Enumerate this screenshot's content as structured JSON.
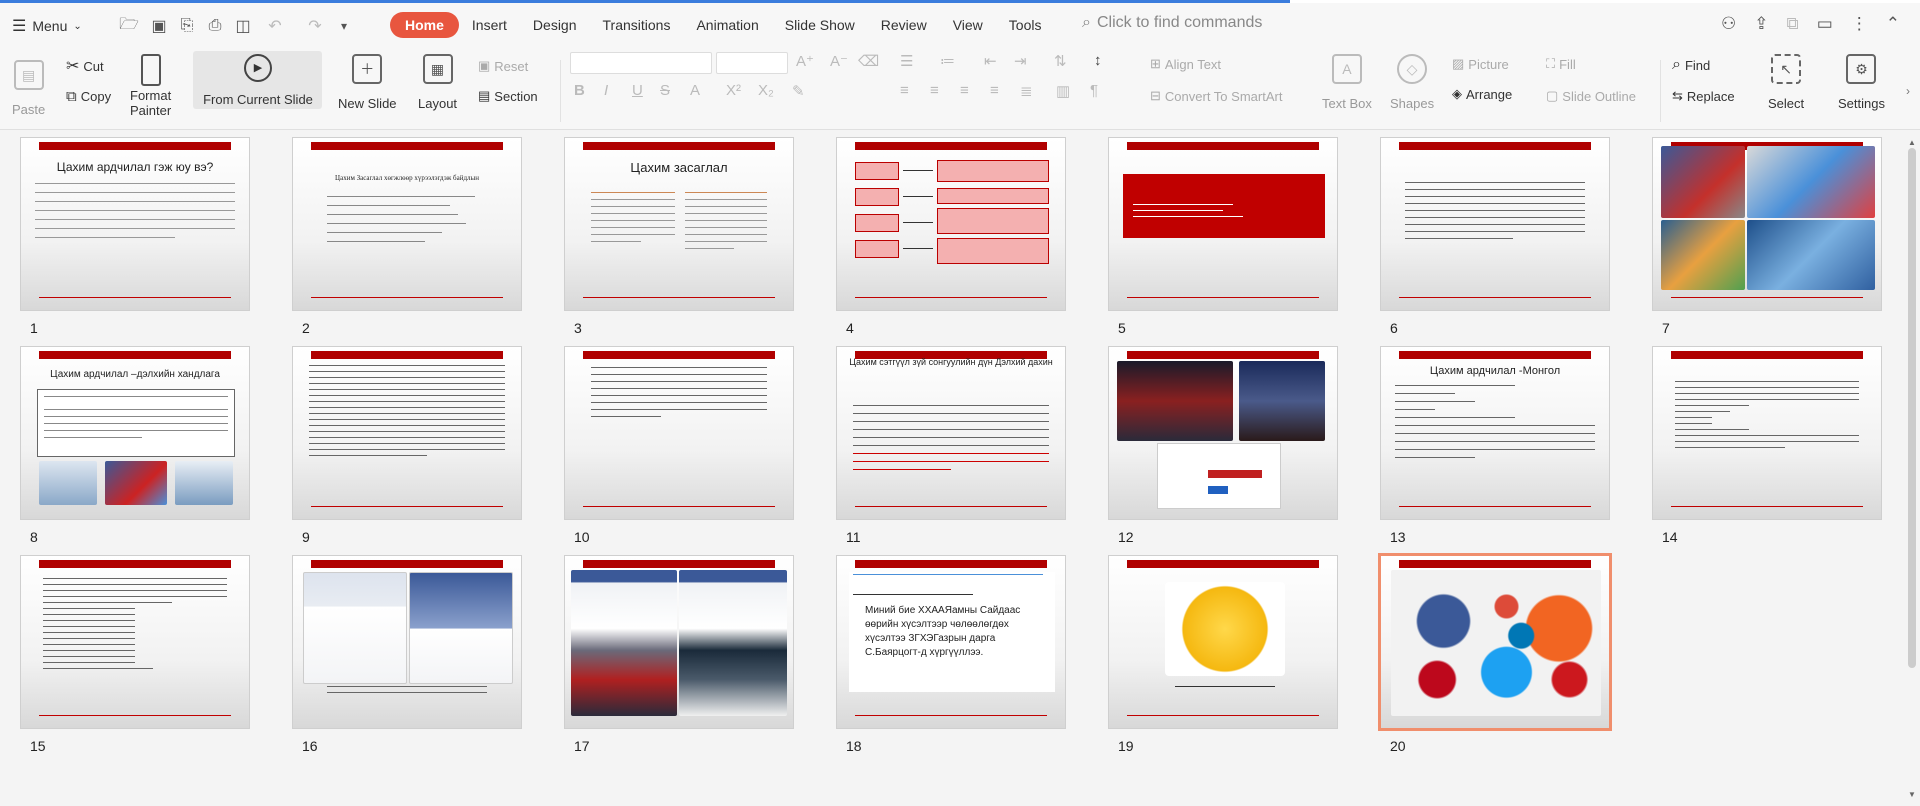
{
  "toolbar": {
    "menu_label": "Menu",
    "tabs": [
      "Home",
      "Insert",
      "Design",
      "Transitions",
      "Animation",
      "Slide Show",
      "Review",
      "View",
      "Tools"
    ],
    "search_placeholder": "Click to find commands"
  },
  "ribbon": {
    "paste": "Paste",
    "cut": "Cut",
    "copy": "Copy",
    "format_painter_1": "Format",
    "format_painter_2": "Painter",
    "from_current_slide": "From Current Slide",
    "new_slide": "New Slide",
    "layout": "Layout",
    "reset": "Reset",
    "section": "Section",
    "align_text": "Align Text",
    "convert_smartart": "Convert To SmartArt",
    "text_box": "Text Box",
    "shapes": "Shapes",
    "picture": "Picture",
    "arrange": "Arrange",
    "fill": "Fill",
    "slide_outline": "Slide Outline",
    "find": "Find",
    "replace": "Replace",
    "select": "Select",
    "settings": "Settings"
  },
  "slides": [
    {
      "num": "1",
      "title": "Цахим ардчилал гэж юу вэ?"
    },
    {
      "num": "2",
      "title": "Цахим Засаглал хөгжлөөр хүрээлэгдэж байдлын"
    },
    {
      "num": "3",
      "title": "Цахим засаглал"
    },
    {
      "num": "4",
      "title": ""
    },
    {
      "num": "5",
      "title": ""
    },
    {
      "num": "6",
      "title": ""
    },
    {
      "num": "7",
      "title": ""
    },
    {
      "num": "8",
      "title": "Цахим ардчилал –дэлхийн хандлага"
    },
    {
      "num": "9",
      "title": ""
    },
    {
      "num": "10",
      "title": ""
    },
    {
      "num": "11",
      "title": "Цахим сэтгүүл зүй сонгуулийн дүн Дэлхий дахин"
    },
    {
      "num": "12",
      "title": ""
    },
    {
      "num": "13",
      "title": "Цахим ардчилал -Монгол"
    },
    {
      "num": "14",
      "title": ""
    },
    {
      "num": "15",
      "title": ""
    },
    {
      "num": "16",
      "title": ""
    },
    {
      "num": "17",
      "title": ""
    },
    {
      "num": "18",
      "title": "Миний бие ХХААЯамны Сайдаас өөрийн хүсэлтээр чөлөөлөгдөх хүсэлтээ ЗГХЭГазрын дарга С.Баярцогт-д хүргүүллээ."
    },
    {
      "num": "19",
      "title": ""
    },
    {
      "num": "20",
      "title": ""
    }
  ],
  "colors": {
    "accent": "#e8563f",
    "slide_bar": "#b00000",
    "selected_border": "#f08e6c"
  }
}
